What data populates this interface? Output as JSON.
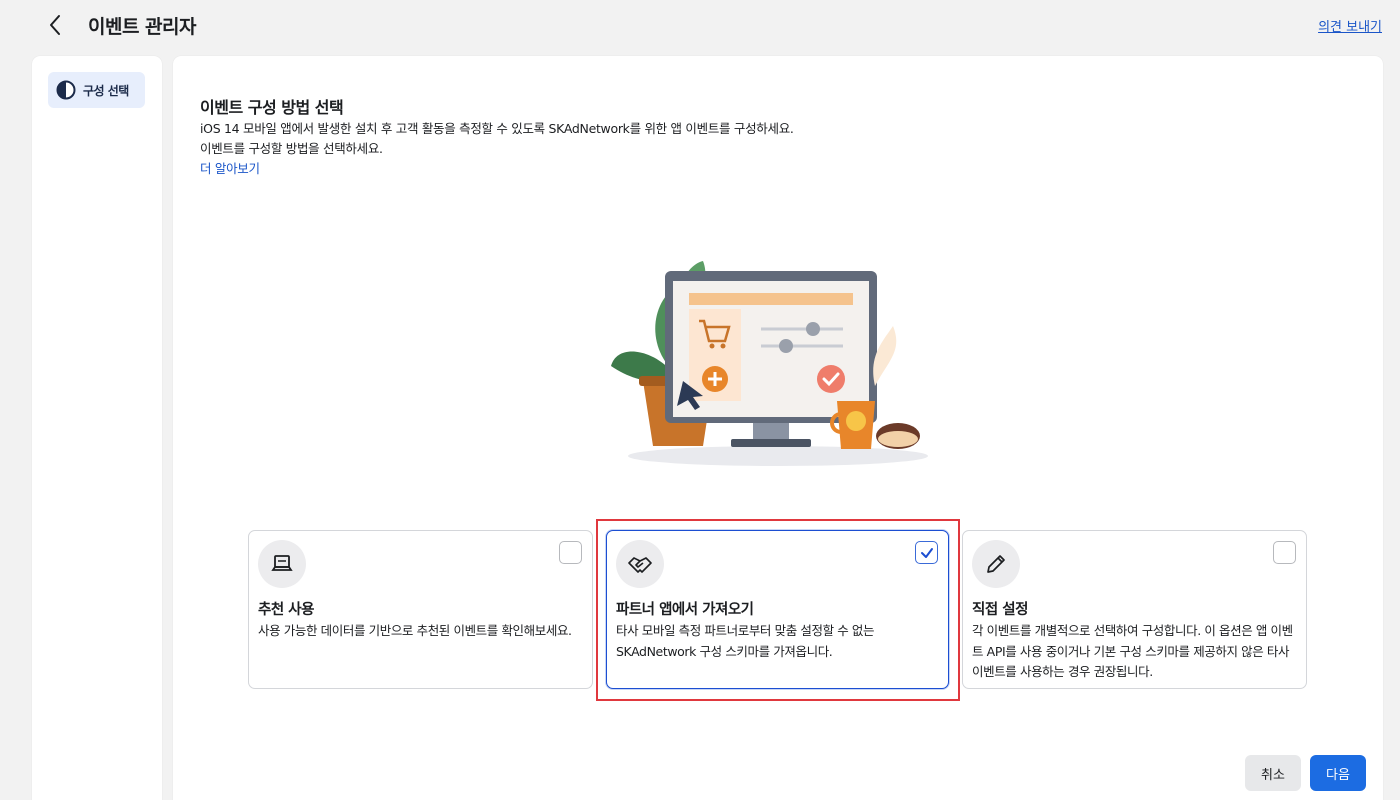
{
  "header": {
    "title": "이벤트 관리자",
    "feedback_label": "의견 보내기"
  },
  "sidebar": {
    "items": [
      {
        "label": "구성 선택",
        "icon": "half-circle-icon"
      }
    ]
  },
  "main": {
    "title": "이벤트 구성 방법 선택",
    "description_line1": "iOS 14 모바일 앱에서 발생한 설치 후 고객 활동을 측정할 수 있도록 SKAdNetwork를 위한 앱 이벤트를 구성하세요.",
    "description_line2": "이벤트를 구성할 방법을 선택하세요.",
    "learn_more": "더 알아보기"
  },
  "options": [
    {
      "title": "추천 사용",
      "description": "사용 가능한 데이터를 기반으로 추천된 이벤트를 확인해보세요.",
      "icon": "laptop-icon",
      "selected": false
    },
    {
      "title": "파트너 앱에서 가져오기",
      "description": "타사 모바일 측정 파트너로부터 맞춤 설정할 수 없는 SKAdNetwork 구성 스키마를 가져옵니다.",
      "icon": "handshake-icon",
      "selected": true
    },
    {
      "title": "직접 설정",
      "description": "각 이벤트를 개별적으로 선택하여 구성합니다. 이 옵션은 앱 이벤트 API를 사용 중이거나 기본 구성 스키마를 제공하지 않은 타사 이벤트를 사용하는 경우 권장됩니다.",
      "icon": "pencil-icon",
      "selected": false
    }
  ],
  "footer": {
    "cancel_label": "취소",
    "next_label": "다음"
  },
  "colors": {
    "accent": "#1c6ce2",
    "link": "#1a55c8",
    "highlight": "#e0383e"
  }
}
